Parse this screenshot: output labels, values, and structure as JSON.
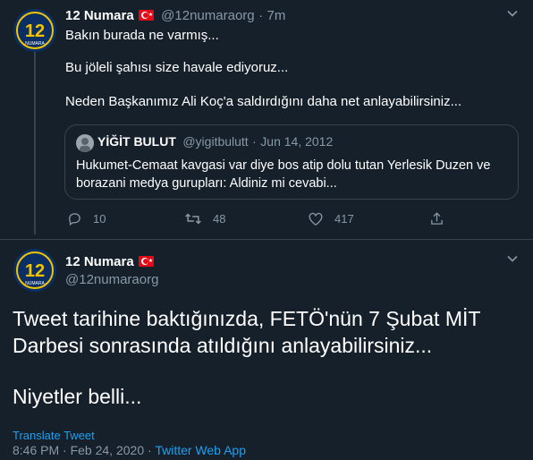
{
  "tweet1": {
    "display_name": "12 Numara",
    "handle": "@12numaraorg",
    "separator": "·",
    "time": "7m",
    "lines": [
      "Bakın burada ne varmış...",
      "Bu jöleli şahısı size havale ediyoruz...",
      "Neden Başkanımız Ali Koç'a saldırdığını daha net anlayabilirsiniz..."
    ],
    "quote": {
      "display_name": "YİĞİT BULUT",
      "handle": "@yigitbulutt",
      "separator": "·",
      "date": "Jun 14, 2012",
      "text_line1": "Hukumet-Cemaat kavgasi var diye bos atip dolu tutan Yerlesik Duzen ve",
      "text_line2": "borazani medya gurupları: Aldiniz mi cevabi..."
    },
    "actions": {
      "replies": "10",
      "retweets": "48",
      "likes": "417"
    }
  },
  "tweet2": {
    "display_name": "12 Numara",
    "handle": "@12numaraorg",
    "text_line1": "Tweet tarihine baktığınızda, FETÖ'nün 7 Şubat MİT",
    "text_line2": "Darbesi sonrasında atıldığını anlayabilirsiniz...",
    "text_line3": "Niyetler belli...",
    "translate": "Translate Tweet",
    "time": "8:46 PM",
    "separator": "·",
    "date": "Feb 24, 2020",
    "source": "Twitter Web App"
  },
  "avatar_badge": "12",
  "avatar_sub": "NUMARA",
  "colors": {
    "background": "#15202b",
    "muted": "#8899a6",
    "accent": "#1da1f2",
    "border": "#38444d"
  },
  "icons": [
    "reply-icon",
    "retweet-icon",
    "like-icon",
    "share-icon",
    "caret-icon",
    "flag-icon"
  ]
}
